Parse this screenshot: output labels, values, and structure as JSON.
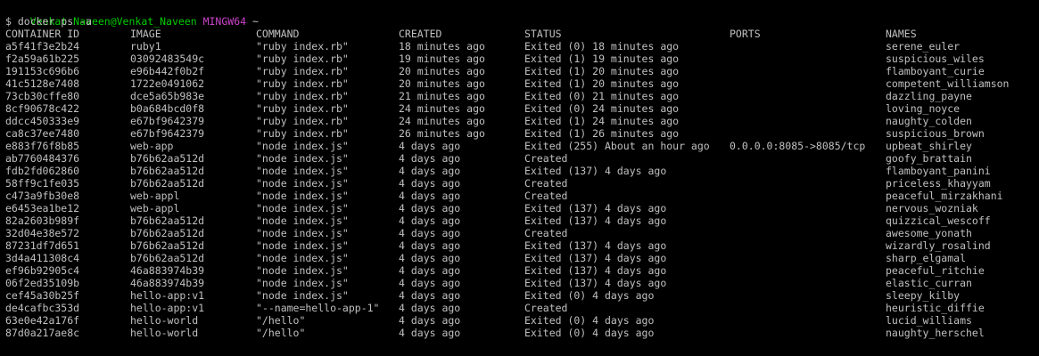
{
  "prompt": {
    "user_host": "Venkat Naveen@Venkat_Naveen",
    "shell": "MINGW64",
    "dir": "~"
  },
  "command": "$ docker ps -a",
  "headers": [
    "CONTAINER ID",
    "IMAGE",
    "COMMAND",
    "CREATED",
    "STATUS",
    "PORTS",
    "NAMES"
  ],
  "rows": [
    [
      "a5f41f3e2b24",
      "ruby1",
      "\"ruby index.rb\"",
      "18 minutes ago",
      "Exited (0) 18 minutes ago",
      "",
      "serene_euler"
    ],
    [
      "f2a59a61b225",
      "03092483549c",
      "\"ruby index.rb\"",
      "19 minutes ago",
      "Exited (1) 19 minutes ago",
      "",
      "suspicious_wiles"
    ],
    [
      "191153c696b6",
      "e96b442f0b2f",
      "\"ruby index.rb\"",
      "20 minutes ago",
      "Exited (1) 20 minutes ago",
      "",
      "flamboyant_curie"
    ],
    [
      "41c5128e7408",
      "1722e0491062",
      "\"ruby index.rb\"",
      "20 minutes ago",
      "Exited (1) 20 minutes ago",
      "",
      "competent_williamson"
    ],
    [
      "73cb30cffe80",
      "dce5a65b983e",
      "\"ruby index.rb\"",
      "21 minutes ago",
      "Exited (0) 21 minutes ago",
      "",
      "dazzling_payne"
    ],
    [
      "8cf90678c422",
      "b0a684bcd0f8",
      "\"ruby index.rb\"",
      "24 minutes ago",
      "Exited (0) 24 minutes ago",
      "",
      "loving_noyce"
    ],
    [
      "ddcc450333e9",
      "e67bf9642379",
      "\"ruby index.rb\"",
      "24 minutes ago",
      "Exited (1) 24 minutes ago",
      "",
      "naughty_colden"
    ],
    [
      "ca8c37ee7480",
      "e67bf9642379",
      "\"ruby index.rb\"",
      "26 minutes ago",
      "Exited (1) 26 minutes ago",
      "",
      "suspicious_brown"
    ],
    [
      "e883f76f8b85",
      "web-app",
      "\"node index.js\"",
      "4 days ago",
      "Exited (255) About an hour ago",
      "0.0.0.0:8085->8085/tcp",
      "upbeat_shirley"
    ],
    [
      "ab7760484376",
      "b76b62aa512d",
      "\"node index.js\"",
      "4 days ago",
      "Created",
      "",
      "goofy_brattain"
    ],
    [
      "fdb2fd062860",
      "b76b62aa512d",
      "\"node index.js\"",
      "4 days ago",
      "Exited (137) 4 days ago",
      "",
      "flamboyant_panini"
    ],
    [
      "58ff9c1fe035",
      "b76b62aa512d",
      "\"node index.js\"",
      "4 days ago",
      "Created",
      "",
      "priceless_khayyam"
    ],
    [
      "c473a9fb30e8",
      "web-appl",
      "\"node index.js\"",
      "4 days ago",
      "Created",
      "",
      "peaceful_mirzakhani"
    ],
    [
      "e6453ea1be12",
      "web-appl",
      "\"node index.js\"",
      "4 days ago",
      "Exited (137) 4 days ago",
      "",
      "nervous_wozniak"
    ],
    [
      "82a2603b989f",
      "b76b62aa512d",
      "\"node index.js\"",
      "4 days ago",
      "Exited (137) 4 days ago",
      "",
      "quizzical_wescoff"
    ],
    [
      "32d04e38e572",
      "b76b62aa512d",
      "\"node index.js\"",
      "4 days ago",
      "Created",
      "",
      "awesome_yonath"
    ],
    [
      "87231df7d651",
      "b76b62aa512d",
      "\"node index.js\"",
      "4 days ago",
      "Exited (137) 4 days ago",
      "",
      "wizardly_rosalind"
    ],
    [
      "3d4a411308c4",
      "b76b62aa512d",
      "\"node index.js\"",
      "4 days ago",
      "Exited (137) 4 days ago",
      "",
      "sharp_elgamal"
    ],
    [
      "ef96b92905c4",
      "46a883974b39",
      "\"node index.js\"",
      "4 days ago",
      "Exited (137) 4 days ago",
      "",
      "peaceful_ritchie"
    ],
    [
      "06f2ed35109b",
      "46a883974b39",
      "\"node index.js\"",
      "4 days ago",
      "Exited (137) 4 days ago",
      "",
      "elastic_curran"
    ],
    [
      "cef45a30b25f",
      "hello-app:v1",
      "\"node index.js\"",
      "4 days ago",
      "Exited (0) 4 days ago",
      "",
      "sleepy_kilby"
    ],
    [
      "de4cafbc353d",
      "hello-app:v1",
      "\"--name=hello-app-1\"",
      "4 days ago",
      "Created",
      "",
      "heuristic_diffie"
    ],
    [
      "63e0e42a176f",
      "hello-world",
      "\"/hello\"",
      "4 days ago",
      "Exited (0) 4 days ago",
      "",
      "lucid_williams"
    ],
    [
      "87d0a217ae8c",
      "hello-world",
      "\"/hello\"",
      "4 days ago",
      "Exited (0) 4 days ago",
      "",
      "naughty_herschel"
    ]
  ],
  "colors": {
    "background": "#000000",
    "text": "#c0c0c0",
    "prompt_user": "#00cc00",
    "prompt_shell": "#cc44cc"
  }
}
